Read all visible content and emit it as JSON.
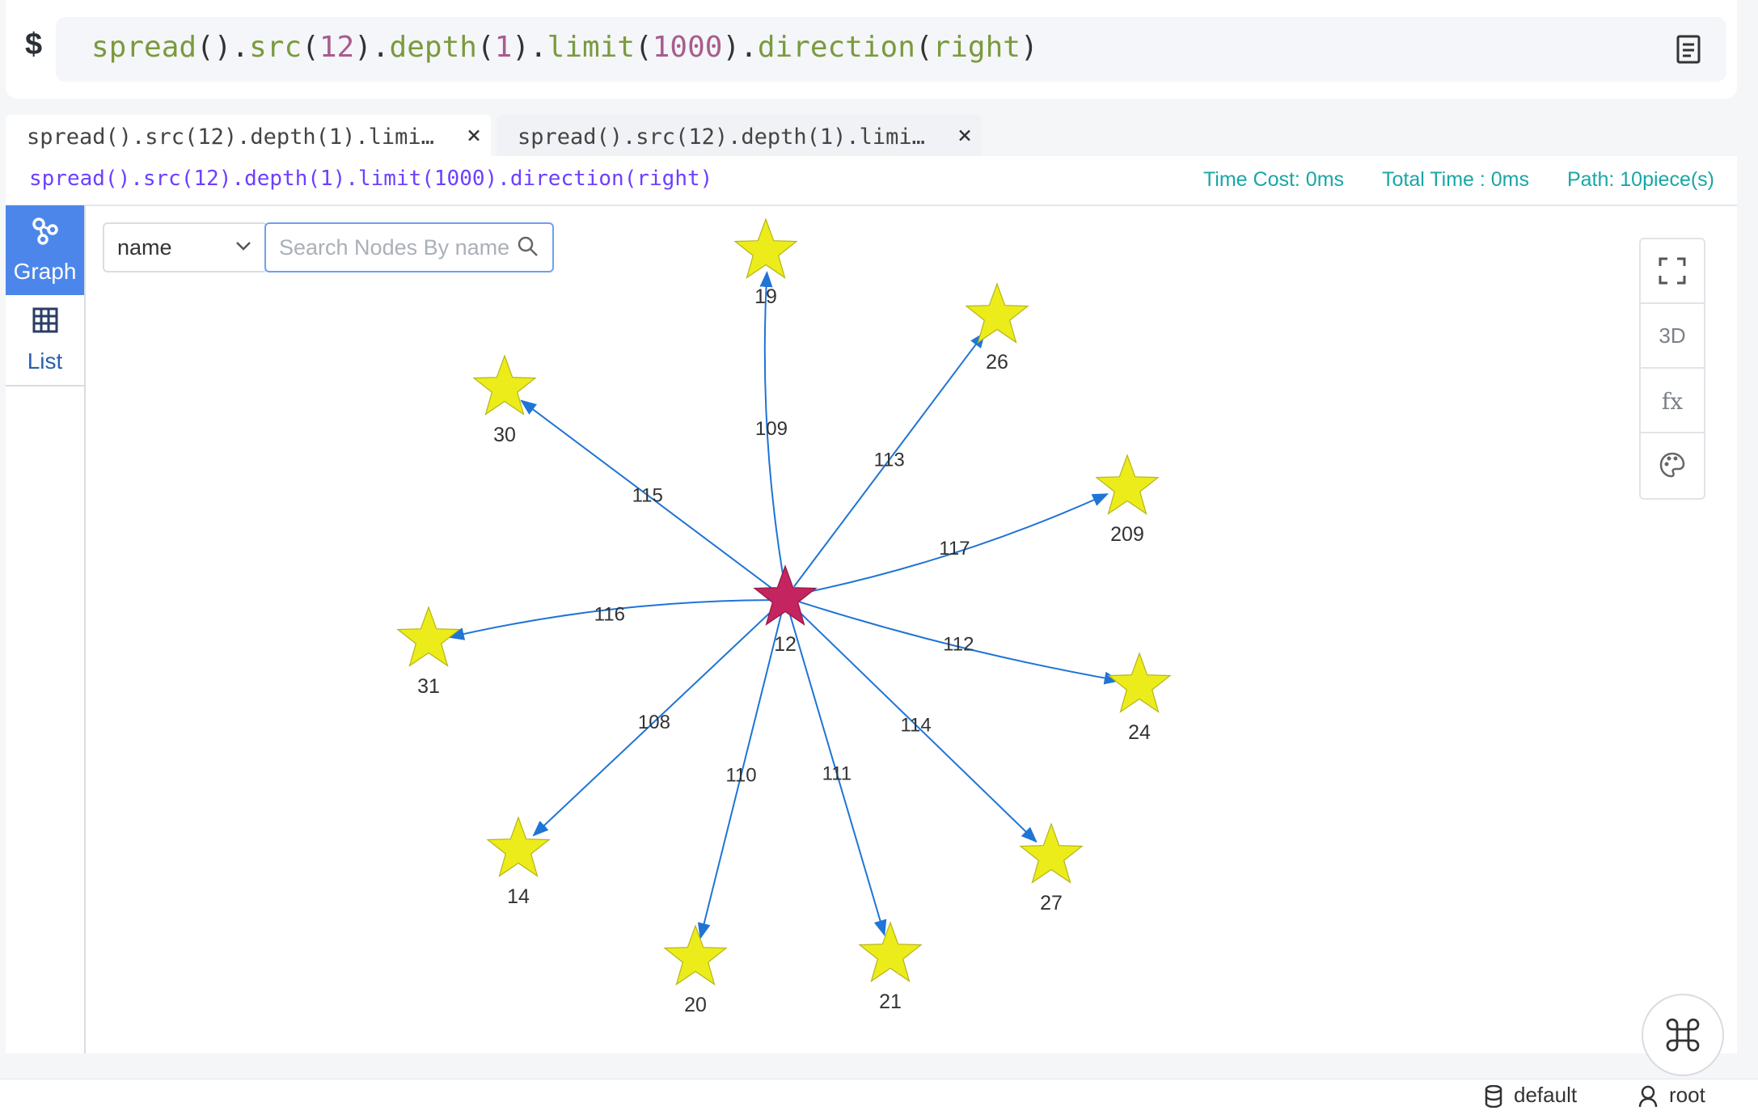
{
  "command": {
    "prompt": "$",
    "tokens": [
      {
        "t": "spread",
        "k": "fn"
      },
      {
        "t": "()",
        "k": "p"
      },
      {
        "t": ".",
        "k": "p"
      },
      {
        "t": "src",
        "k": "fn"
      },
      {
        "t": "(",
        "k": "p"
      },
      {
        "t": "12",
        "k": "num"
      },
      {
        "t": ")",
        "k": "p"
      },
      {
        "t": ".",
        "k": "p"
      },
      {
        "t": "depth",
        "k": "fn"
      },
      {
        "t": "(",
        "k": "p"
      },
      {
        "t": "1",
        "k": "num"
      },
      {
        "t": ")",
        "k": "p"
      },
      {
        "t": ".",
        "k": "p"
      },
      {
        "t": "limit",
        "k": "fn"
      },
      {
        "t": "(",
        "k": "p"
      },
      {
        "t": "1000",
        "k": "num"
      },
      {
        "t": ")",
        "k": "p"
      },
      {
        "t": ".",
        "k": "p"
      },
      {
        "t": "direction",
        "k": "fn"
      },
      {
        "t": "(",
        "k": "p"
      },
      {
        "t": "right",
        "k": "fn"
      },
      {
        "t": ")",
        "k": "p"
      }
    ],
    "doc_icon": "document-icon"
  },
  "tabs": [
    {
      "label": "spread().src(12).depth(1).limi…",
      "close": "×",
      "active": true
    },
    {
      "label": "spread().src(12).depth(1).limi…",
      "close": "×",
      "active": false
    }
  ],
  "result": {
    "query": "spread().src(12).depth(1).limit(1000).direction(right)",
    "time_cost": "Time Cost: 0ms",
    "total_time": "Total Time : 0ms",
    "path": "Path: 10piece(s)"
  },
  "sidebar": {
    "graph_label": "Graph",
    "list_label": "List"
  },
  "search": {
    "field_value": "name",
    "placeholder": "Search Nodes By name"
  },
  "toolbar": {
    "fullscreen_icon": "fullscreen-icon",
    "three_d": "3D",
    "fx": "fx",
    "palette_icon": "palette-icon"
  },
  "graph": {
    "center": "12",
    "colors": {
      "center": "#c4245f",
      "node": "#ecec1a",
      "edge": "#1f74d6"
    },
    "nodes": [
      {
        "id": "12",
        "center": true
      },
      {
        "id": "19"
      },
      {
        "id": "26"
      },
      {
        "id": "30"
      },
      {
        "id": "209"
      },
      {
        "id": "31"
      },
      {
        "id": "24"
      },
      {
        "id": "14"
      },
      {
        "id": "20"
      },
      {
        "id": "21"
      },
      {
        "id": "27"
      }
    ],
    "edges": [
      {
        "label": "109",
        "target": "19"
      },
      {
        "label": "113",
        "target": "26"
      },
      {
        "label": "115",
        "target": "30"
      },
      {
        "label": "117",
        "target": "209"
      },
      {
        "label": "116",
        "target": "31"
      },
      {
        "label": "112",
        "target": "24"
      },
      {
        "label": "108",
        "target": "14"
      },
      {
        "label": "110",
        "target": "20"
      },
      {
        "label": "111",
        "target": "21"
      },
      {
        "label": "114",
        "target": "27"
      }
    ]
  },
  "status": {
    "database": "default",
    "user": "root"
  }
}
